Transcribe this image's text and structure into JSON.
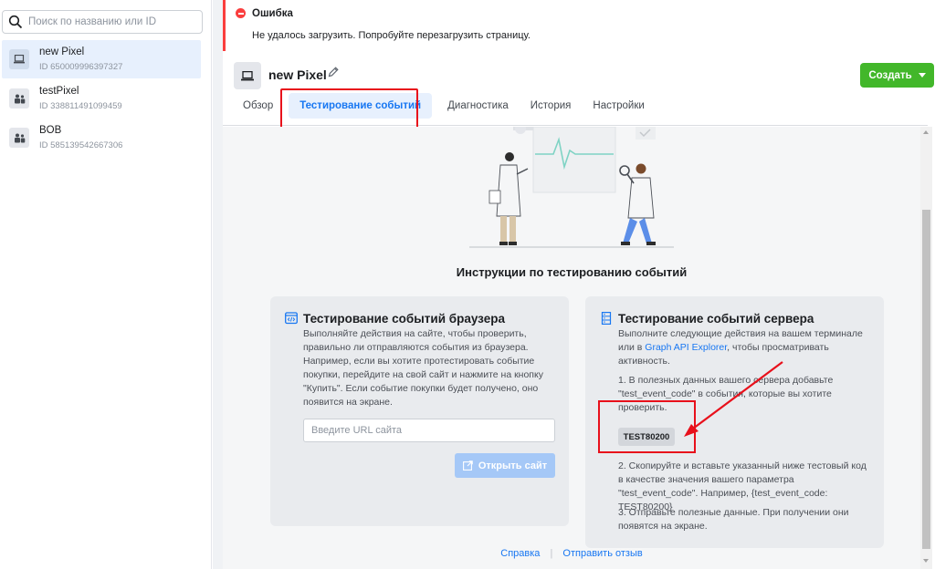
{
  "sidebar": {
    "search_placeholder": "Поиск по названию или ID",
    "items": [
      {
        "name": "new Pixel",
        "id": "ID 650009996397327",
        "selected": true,
        "icon": "laptop-icon"
      },
      {
        "name": "testPixel",
        "id": "ID 338811491099459",
        "selected": false,
        "icon": "people-icon"
      },
      {
        "name": "BOB",
        "id": "ID 585139542667306",
        "selected": false,
        "icon": "people-icon"
      }
    ]
  },
  "error": {
    "title": "Ошибка",
    "message": "Не удалось загрузить. Попробуйте перезагрузить страницу.",
    "color": "#fa3e3e"
  },
  "header": {
    "title": "new Pixel",
    "create_button": "Создать",
    "tabs": [
      {
        "label": "Обзор",
        "active": false
      },
      {
        "label": "Тестирование событий",
        "active": true
      },
      {
        "label": "Диагностика",
        "active": false
      },
      {
        "label": "История",
        "active": false
      },
      {
        "label": "Настройки",
        "active": false
      }
    ]
  },
  "content": {
    "instructions_title": "Инструкции по тестированию событий",
    "browser_card": {
      "title": "Тестирование событий браузера",
      "text": "Выполняйте действия на сайте, чтобы проверить, правильно ли отправляются события из браузера. Например, если вы хотите протестировать событие покупки, перейдите на свой сайт и нажмите на кнопку \"Купить\". Если событие покупки будет получено, оно появится на экране.",
      "url_placeholder": "Введите URL сайта",
      "open_button": "Открыть сайт"
    },
    "server_card": {
      "title": "Тестирование событий сервера",
      "p1_before": "Выполните следующие действия на вашем терминале или в ",
      "p1_link": "Graph API Explorer",
      "p1_after": ", чтобы просматривать активность.",
      "step1": "1. В полезных данных вашего сервера добавьте \"test_event_code\" в события, которые вы хотите проверить.",
      "test_code": "TEST80200",
      "step2": "2. Скопируйте и вставьте указанный ниже тестовый код в качестве значения вашего параметра \"test_event_code\". Например, {test_event_code: TEST80200}",
      "step3": "3. Отправьте полезные данные. При получении они появятся на экране."
    },
    "footer": {
      "help": "Справка",
      "separator": "|",
      "feedback": "Отправить отзыв"
    }
  },
  "colors": {
    "accent": "#1877f2",
    "create_green": "#42b72a",
    "annotation_red": "#e8101b"
  }
}
